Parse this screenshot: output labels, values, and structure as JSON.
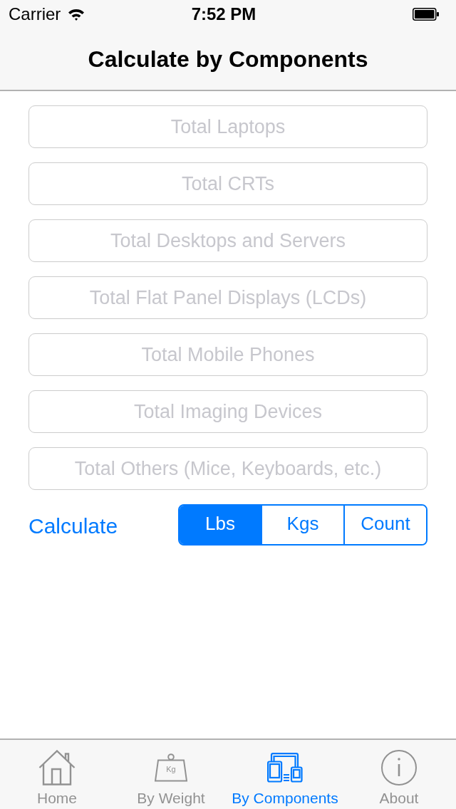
{
  "status_bar": {
    "carrier": "Carrier",
    "time": "7:52 PM"
  },
  "nav_bar": {
    "title": "Calculate by Components"
  },
  "fields": [
    {
      "placeholder": "Total Laptops"
    },
    {
      "placeholder": "Total CRTs"
    },
    {
      "placeholder": "Total Desktops and Servers"
    },
    {
      "placeholder": "Total Flat Panel Displays (LCDs)"
    },
    {
      "placeholder": "Total Mobile Phones"
    },
    {
      "placeholder": "Total Imaging Devices"
    },
    {
      "placeholder": "Total Others (Mice, Keyboards, etc.)"
    }
  ],
  "calculate_button": {
    "label": "Calculate"
  },
  "unit_segments": [
    {
      "label": "Lbs",
      "selected": true
    },
    {
      "label": "Kgs",
      "selected": false
    },
    {
      "label": "Count",
      "selected": false
    }
  ],
  "tab_bar": [
    {
      "label": "Home",
      "kind": "home",
      "selected": false
    },
    {
      "label": "By Weight",
      "kind": "weight",
      "icon_text": "Kg",
      "selected": false
    },
    {
      "label": "By Components",
      "kind": "devices",
      "selected": true
    },
    {
      "label": "About",
      "kind": "info",
      "selected": false
    }
  ]
}
